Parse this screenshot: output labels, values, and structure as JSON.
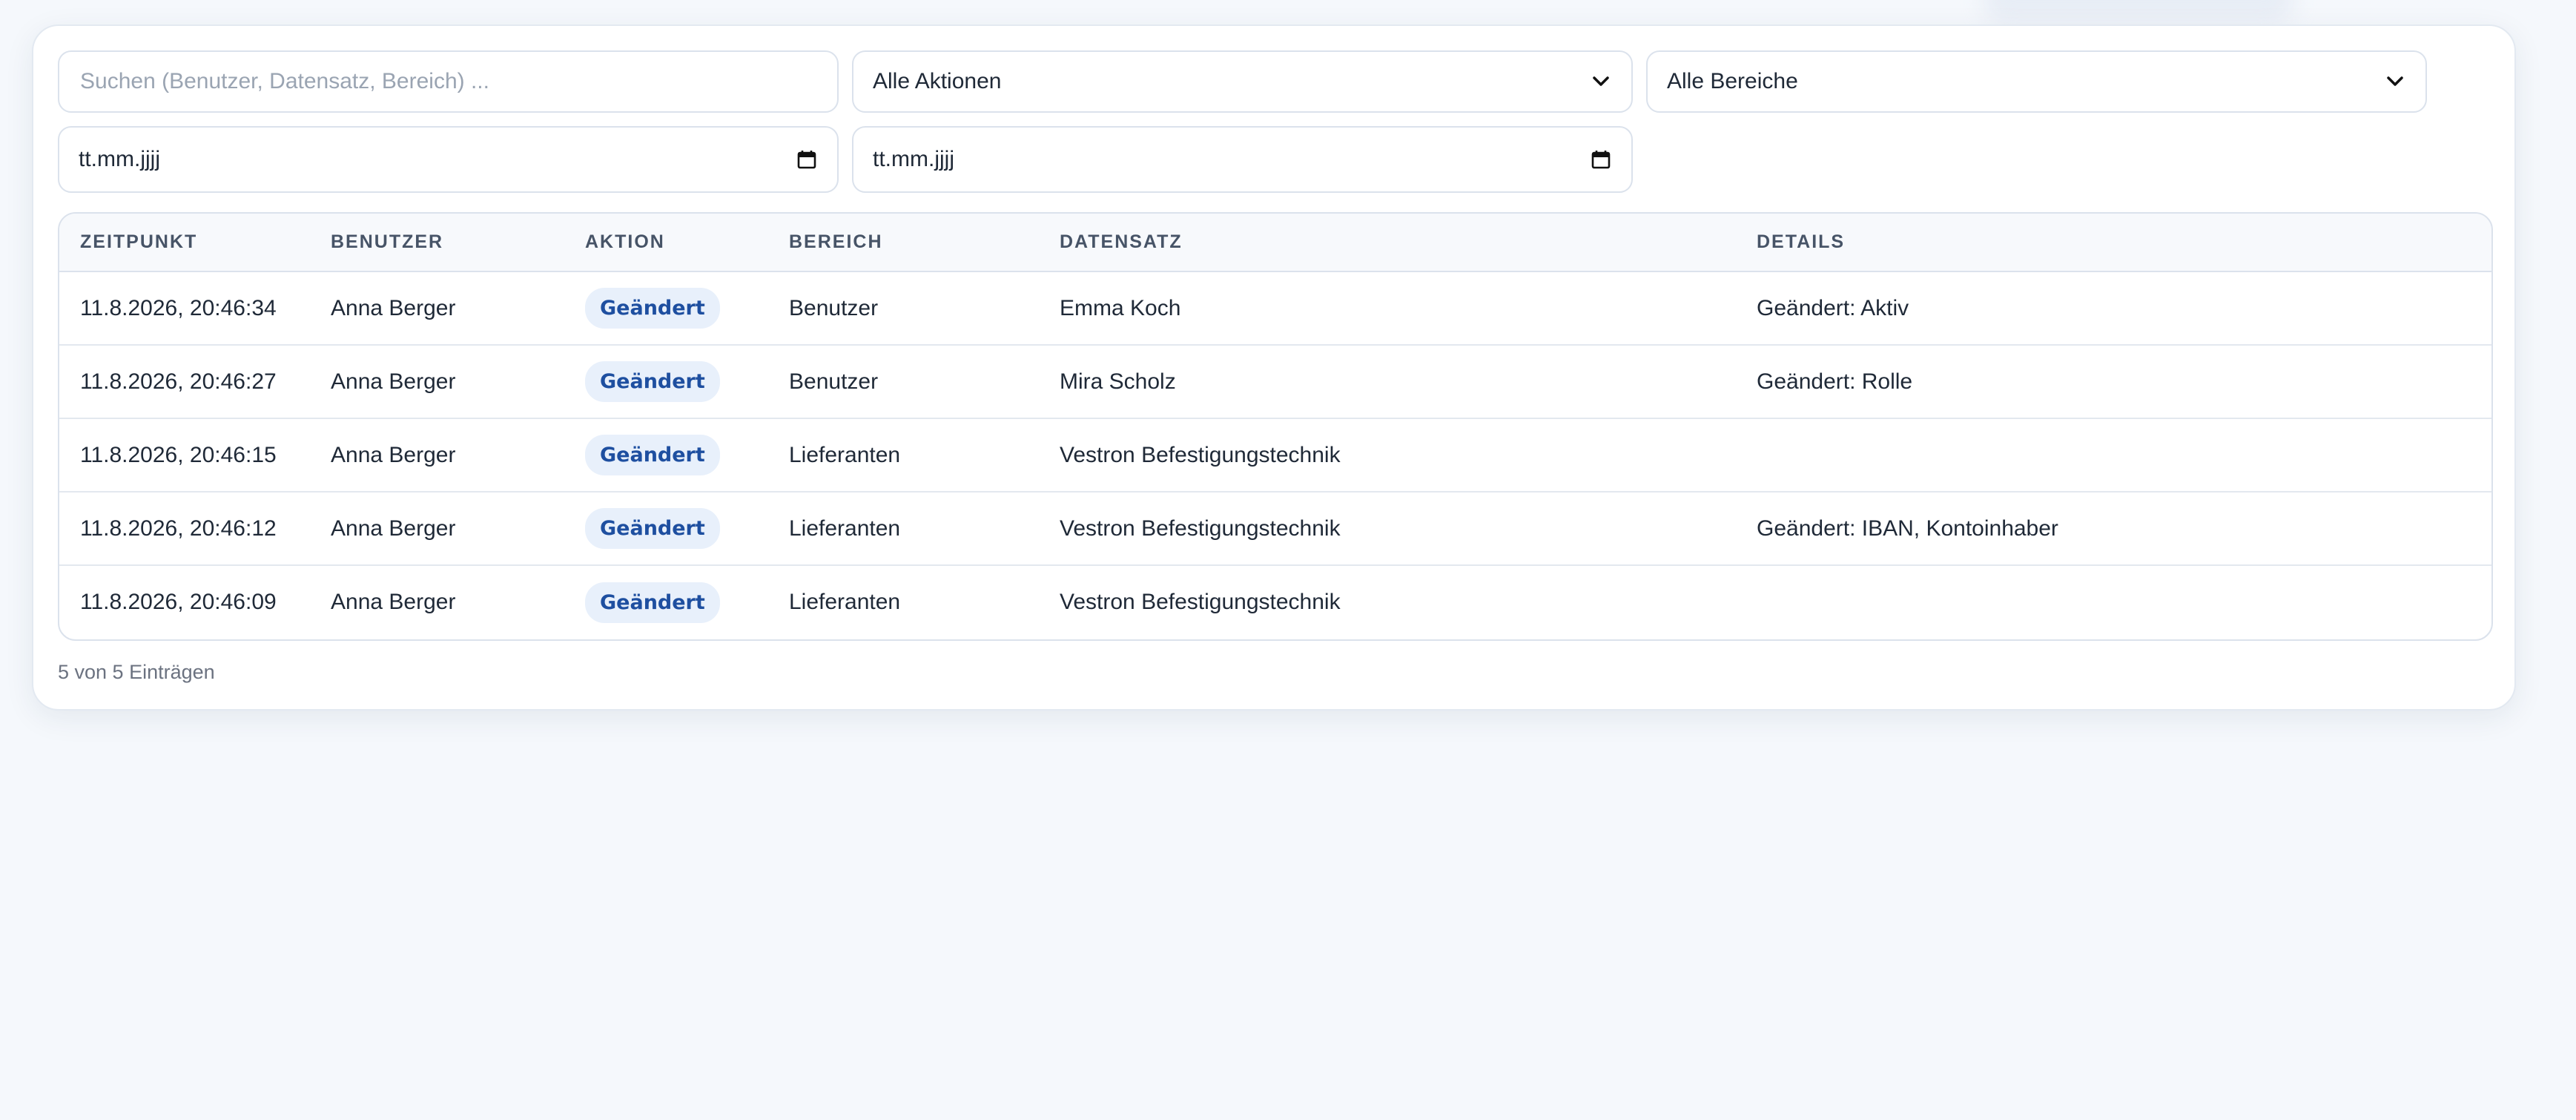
{
  "filters": {
    "search_placeholder": "Suchen (Benutzer, Datensatz, Bereich) ...",
    "search_value": "",
    "action_select": "Alle Aktionen",
    "area_select": "Alle Bereiche",
    "date_from": "tt.mm.jjjj",
    "date_to": "tt.mm.jjjj"
  },
  "table": {
    "headers": {
      "time": "ZEITPUNKT",
      "user": "BENUTZER",
      "action": "AKTION",
      "area": "BEREICH",
      "record": "DATENSATZ",
      "details": "DETAILS"
    },
    "rows": [
      {
        "time": "11.8.2026, 20:46:34",
        "user": "Anna Berger",
        "action": "Geändert",
        "area": "Benutzer",
        "record": "Emma Koch",
        "details": "Geändert: Aktiv"
      },
      {
        "time": "11.8.2026, 20:46:27",
        "user": "Anna Berger",
        "action": "Geändert",
        "area": "Benutzer",
        "record": "Mira Scholz",
        "details": "Geändert: Rolle"
      },
      {
        "time": "11.8.2026, 20:46:15",
        "user": "Anna Berger",
        "action": "Geändert",
        "area": "Lieferanten",
        "record": "Vestron Befestigungstechnik",
        "details": ""
      },
      {
        "time": "11.8.2026, 20:46:12",
        "user": "Anna Berger",
        "action": "Geändert",
        "area": "Lieferanten",
        "record": "Vestron Befestigungstechnik",
        "details": "Geändert: IBAN, Kontoinhaber"
      },
      {
        "time": "11.8.2026, 20:46:09",
        "user": "Anna Berger",
        "action": "Geändert",
        "area": "Lieferanten",
        "record": "Vestron Befestigungstechnik",
        "details": ""
      }
    ]
  },
  "footer": {
    "count_text": "5 von 5 Einträgen"
  },
  "colors": {
    "badge_bg": "#e8f0fb",
    "badge_text": "#1e4fa0",
    "page_bg": "#f5f8fc"
  }
}
